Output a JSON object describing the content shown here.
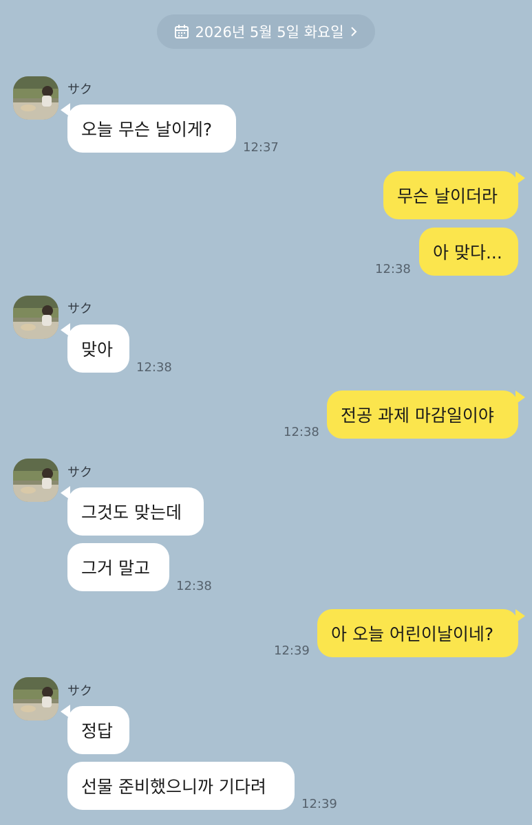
{
  "date_divider": {
    "label": "2026년 5월 5일 화요일",
    "icon": "calendar-icon",
    "chevron": "chevron-right-icon"
  },
  "contact": {
    "name": "サク",
    "avatar": "avatar-photo"
  },
  "colors": {
    "background": "#abc1d1",
    "incoming_bubble": "#ffffff",
    "outgoing_bubble": "#fbe54d",
    "time_text": "#55616c"
  },
  "messages": [
    {
      "sender": "contact",
      "name": "サク",
      "text": "오늘 무슨 날이게?",
      "time": "12:37"
    },
    {
      "sender": "me",
      "text": "무슨 날이더라"
    },
    {
      "sender": "me",
      "text": "아 맞다...",
      "time": "12:38"
    },
    {
      "sender": "contact",
      "name": "サク",
      "text": "맞아",
      "time": "12:38"
    },
    {
      "sender": "me",
      "text": "전공 과제 마감일이야",
      "time": "12:38"
    },
    {
      "sender": "contact",
      "name": "サク",
      "text": "그것도 맞는데"
    },
    {
      "sender": "contact",
      "text": "그거 말고",
      "time": "12:38"
    },
    {
      "sender": "me",
      "text": "아 오늘 어린이날이네?",
      "time": "12:39"
    },
    {
      "sender": "contact",
      "name": "サク",
      "text": "정답"
    },
    {
      "sender": "contact",
      "text": "선물 준비했으니까 기다려",
      "time": "12:39"
    }
  ]
}
